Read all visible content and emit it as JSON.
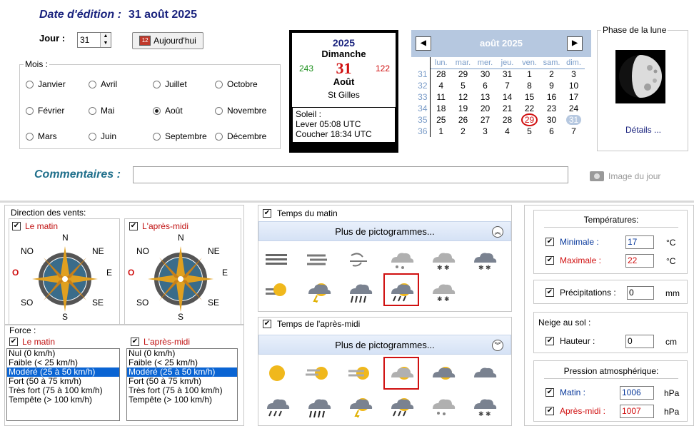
{
  "header": {
    "date_label": "Date d'édition :",
    "date_value": "31 août 2025",
    "jour_label": "Jour :",
    "jour_value": "31",
    "today_button": "Aujourd'hui"
  },
  "mois": {
    "legend": "Mois :",
    "options": [
      "Janvier",
      "Avril",
      "Juillet",
      "Octobre",
      "Février",
      "Mai",
      "Août",
      "Novembre",
      "Mars",
      "Juin",
      "Septembre",
      "Décembre"
    ],
    "selected": "Août"
  },
  "day_card": {
    "year": "2025",
    "weekday": "Dimanche",
    "left_num": "243",
    "day": "31",
    "right_num": "122",
    "month": "Août",
    "saint": "St Gilles",
    "sun_title": "Soleil :",
    "sunrise": "Lever 05:08 UTC",
    "sunset": "Coucher 18:34 UTC"
  },
  "calendar": {
    "title": "août 2025",
    "prev": "◀",
    "next": "▶",
    "days": [
      "lun.",
      "mar.",
      "mer.",
      "jeu.",
      "ven.",
      "sam.",
      "dim."
    ],
    "weeks": [
      {
        "wk": "31",
        "d": [
          "28",
          "29",
          "30",
          "31",
          "1",
          "2",
          "3"
        ]
      },
      {
        "wk": "32",
        "d": [
          "4",
          "5",
          "6",
          "7",
          "8",
          "9",
          "10"
        ]
      },
      {
        "wk": "33",
        "d": [
          "11",
          "12",
          "13",
          "14",
          "15",
          "16",
          "17"
        ]
      },
      {
        "wk": "34",
        "d": [
          "18",
          "19",
          "20",
          "21",
          "22",
          "23",
          "24"
        ]
      },
      {
        "wk": "35",
        "d": [
          "25",
          "26",
          "27",
          "28",
          "29",
          "30",
          "31"
        ]
      },
      {
        "wk": "36",
        "d": [
          "1",
          "2",
          "3",
          "4",
          "5",
          "6",
          "7"
        ]
      }
    ],
    "today_circled": "29",
    "selected": "31"
  },
  "moon": {
    "legend": "Phase de la lune",
    "details": "Détails ..."
  },
  "comment": {
    "label": "Commentaires :",
    "value": "",
    "image_label": "Image du jour"
  },
  "wind": {
    "legend": "Direction des vents:",
    "morning": "Le matin",
    "afternoon": "L'après-midi",
    "compass": {
      "n": "N",
      "no": "NO",
      "ne": "NE",
      "o": "O",
      "e": "E",
      "so": "SO",
      "se": "SE",
      "s": "S"
    }
  },
  "force": {
    "legend": "Force :",
    "morning": "Le matin",
    "afternoon": "L'après-midi",
    "options": [
      "Nul (0 km/h)",
      "Faible (< 25 km/h)",
      "Modéré (25 à 50 km/h)",
      "Fort (50 à 75 km/h)",
      "Très fort (75 à 100 km/h)",
      "Tempête (> 100 km/h)"
    ],
    "selected_index": 2
  },
  "weather": {
    "morning_label": "Temps du matin",
    "afternoon_label": "Temps de l'après-midi",
    "more": "Plus de pictogrammes...",
    "collapse_icon": "chevron-up",
    "expand_icon": "chevron-down",
    "morning_icons": [
      "fog",
      "haze-wind",
      "wind",
      "cloud-hail",
      "cloud-snow-light",
      "cloud-heavy-snow",
      "sun-fog",
      "sun-rain-storm",
      "rain-wind",
      "sun-cloud-rain",
      "cloud-hail-snow"
    ],
    "morning_selected": "sun-cloud-rain",
    "afternoon_icons": [
      "sun",
      "sun-cloud-wind",
      "sun-haze",
      "sun-behind-cloud",
      "cloud-sun-dark",
      "cloud",
      "cloud-rain",
      "cloud-heavy-rain",
      "cloud-storm",
      "sun-cloud-rain",
      "cloud-hail",
      "cloud-snow"
    ],
    "afternoon_selected": "sun-behind-cloud"
  },
  "temps": {
    "title": "Températures:",
    "min_label": "Minimale :",
    "min_value": "17",
    "max_label": "Maximale :",
    "max_value": "22",
    "unit": "°C",
    "min_color": "#0a3a9c",
    "max_color": "#d01010"
  },
  "precip": {
    "label": "Précipitations :",
    "value": "0",
    "unit": "mm"
  },
  "neige": {
    "title": "Neige au sol :",
    "label": "Hauteur :",
    "value": "0",
    "unit": "cm"
  },
  "pression": {
    "title": "Pression atmosphérique:",
    "matin_label": "Matin :",
    "matin_value": "1006",
    "pm_label": "Après-midi :",
    "pm_value": "1007",
    "unit": "hPa"
  }
}
